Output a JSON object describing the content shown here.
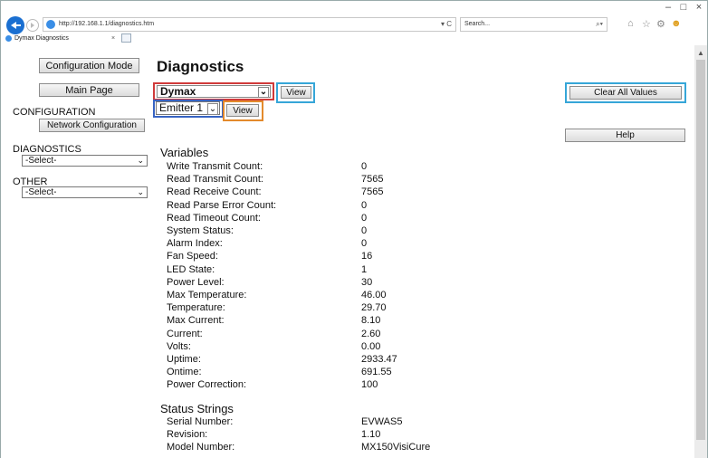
{
  "browser": {
    "url": "http://192.168.1.1/diagnostics.htm",
    "url_icons": "▾ C",
    "search_placeholder": "Search...",
    "tab_title": "Dymax Diagnostics",
    "tab_close": "×",
    "window_controls": [
      "–",
      "□",
      "×"
    ],
    "toolbar_icons": [
      "home-icon",
      "star-icon",
      "gear-icon",
      "smiley-icon"
    ]
  },
  "sidebar": {
    "config_mode_label": "Configuration Mode",
    "main_page_label": "Main Page",
    "configuration_heading": "CONFIGURATION",
    "network_config_label": "Network Configuration",
    "diagnostics_heading": "DIAGNOSTICS",
    "diagnostics_select": "-Select-",
    "other_heading": "OTHER",
    "other_select": "-Select-"
  },
  "main": {
    "title": "Diagnostics",
    "device_select": "Dymax",
    "view_label": "View",
    "emitter_select": "Emitter 1",
    "view2_label": "View",
    "clear_all_label": "Clear All Values",
    "help_label": "Help"
  },
  "variables": {
    "heading": "Variables",
    "rows": [
      {
        "label": "Write Transmit Count:",
        "value": "0"
      },
      {
        "label": "Read Transmit Count:",
        "value": "7565"
      },
      {
        "label": "Read Receive Count:",
        "value": "7565"
      },
      {
        "label": "Read Parse Error Count:",
        "value": "0"
      },
      {
        "label": "Read Timeout Count:",
        "value": "0"
      },
      {
        "label": "System Status:",
        "value": "0"
      },
      {
        "label": "Alarm Index:",
        "value": "0"
      },
      {
        "label": "Fan Speed:",
        "value": "16"
      },
      {
        "label": "LED State:",
        "value": "1"
      },
      {
        "label": "Power Level:",
        "value": "30"
      },
      {
        "label": "Max Temperature:",
        "value": "46.00"
      },
      {
        "label": "Temperature:",
        "value": "29.70"
      },
      {
        "label": "Max Current:",
        "value": "8.10"
      },
      {
        "label": "Current:",
        "value": "2.60"
      },
      {
        "label": "Volts:",
        "value": "0.00"
      },
      {
        "label": "Uptime:",
        "value": "2933.47"
      },
      {
        "label": "Ontime:",
        "value": "691.55"
      },
      {
        "label": "Power Correction:",
        "value": "100"
      }
    ]
  },
  "status_strings": {
    "heading": "Status Strings",
    "rows": [
      {
        "label": "Serial Number:",
        "value": "EVWAS5"
      },
      {
        "label": "Revision:",
        "value": "1.10"
      },
      {
        "label": "Model Number:",
        "value": "MX150VisiCure"
      }
    ]
  },
  "colors": {
    "highlight_red": "#d03a3a",
    "highlight_cyan": "#36a6d8",
    "highlight_blue": "#3763c2",
    "highlight_orange": "#e38a2c"
  }
}
